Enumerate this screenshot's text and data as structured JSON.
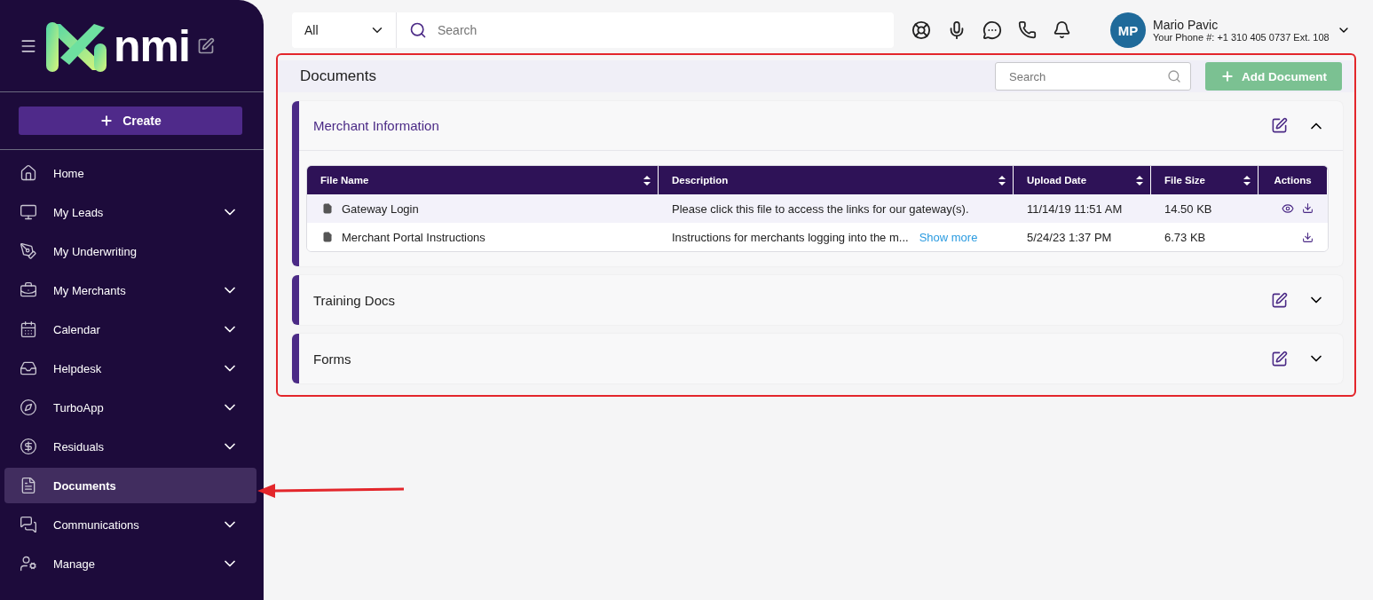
{
  "sidebar": {
    "logo_text": "nmi",
    "create_button": "Create",
    "items": [
      {
        "label": "Home",
        "expandable": false,
        "selected": false
      },
      {
        "label": "My Leads",
        "expandable": true,
        "selected": false
      },
      {
        "label": "My Underwriting",
        "expandable": false,
        "selected": false
      },
      {
        "label": "My Merchants",
        "expandable": true,
        "selected": false
      },
      {
        "label": "Calendar",
        "expandable": true,
        "selected": false
      },
      {
        "label": "Helpdesk",
        "expandable": true,
        "selected": false
      },
      {
        "label": "TurboApp",
        "expandable": true,
        "selected": false
      },
      {
        "label": "Residuals",
        "expandable": true,
        "selected": false
      },
      {
        "label": "Documents",
        "expandable": false,
        "selected": true
      },
      {
        "label": "Communications",
        "expandable": true,
        "selected": false
      },
      {
        "label": "Manage",
        "expandable": true,
        "selected": false
      }
    ]
  },
  "topbar": {
    "scope": "All",
    "search": {
      "placeholder": "Search"
    },
    "user": {
      "initials": "MP",
      "name": "Mario Pavic",
      "phone": "Your Phone #: +1 310 405 0737 Ext. 108"
    }
  },
  "documents": {
    "title": "Documents",
    "search": {
      "placeholder": "Search"
    },
    "add_button": "Add Document",
    "sections": [
      {
        "title": "Merchant Information",
        "expanded": true,
        "table": {
          "columns": [
            {
              "label": "File Name",
              "sortable": true
            },
            {
              "label": "Description",
              "sortable": true
            },
            {
              "label": "Upload Date",
              "sortable": true
            },
            {
              "label": "File Size",
              "sortable": true
            },
            {
              "label": "Actions",
              "sortable": false
            }
          ],
          "rows": [
            {
              "file_name": "Gateway Login",
              "description": "Please click this file to access the links for our gateway(s).",
              "upload_date": "11/14/19 11:51 AM",
              "file_size": "14.50 KB",
              "selected": true,
              "actions": [
                {
                  "kind": "view"
                },
                {
                  "kind": "download"
                }
              ]
            },
            {
              "file_name": "Merchant Portal Instructions",
              "description": "Instructions for merchants logging into the m...",
              "show_more": "Show more",
              "upload_date": "5/24/23 1:37 PM",
              "file_size": "6.73 KB",
              "selected": false,
              "actions": [
                {
                  "kind": "download"
                }
              ]
            }
          ]
        }
      },
      {
        "title": "Training Docs",
        "expanded": false
      },
      {
        "title": "Forms",
        "expanded": false
      }
    ]
  },
  "annotations": [
    {
      "kind": "frame"
    },
    {
      "kind": "arrow"
    }
  ]
}
